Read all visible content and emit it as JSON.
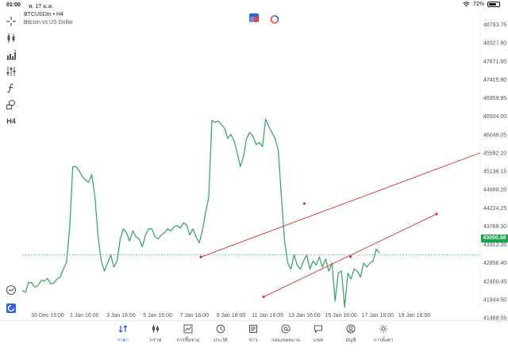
{
  "status_bar": {
    "time": "01:00",
    "date": "พ. 17 ม.ค.",
    "battery": "72%",
    "battery_level": 0.72
  },
  "chart": {
    "symbol": "BTCUSDm",
    "separator": "•",
    "timeframe": "H4",
    "description": "Bitcoin vs US Dollar",
    "last_price": "43050.98",
    "colors": {
      "line": "#3fa66b",
      "trendline": "#e03131",
      "price_tag": "#16a34a"
    }
  },
  "toolbar": {
    "timeframe_button": "H4",
    "icons": [
      "crosshair-icon",
      "candlestick-icon",
      "indicators-icon",
      "settings-sliders-icon",
      "function-icon",
      "objects-icon",
      "timeframe-label"
    ]
  },
  "chart_data": {
    "type": "line",
    "ytick_labels": [
      "48783.75",
      "48327.80",
      "47871.85",
      "47415.90",
      "46959.95",
      "46504.00",
      "46048.05",
      "45592.10",
      "45136.15",
      "44680.20",
      "44224.25",
      "43768.30",
      "43312.35",
      "42856.40",
      "42400.45",
      "41944.50",
      "41488.55"
    ],
    "xtick_labels": [
      "30 Dec 16:00",
      "1 Jan 16:00",
      "3 Jan 16:00",
      "5 Jan 16:00",
      "7 Jan 16:00",
      "9 Jan 16:00",
      "11 Jan 16:00",
      "13 Jan 16:00",
      "15 Jan 16:00",
      "17 Jan 16:00",
      "19 Jan 16:00"
    ],
    "ylim": [
      41488.55,
      48783.75
    ],
    "series": [
      {
        "values": [
          42170,
          42120,
          42370,
          42360,
          42250,
          42290,
          42420,
          42400,
          42470,
          42330,
          42350,
          42450,
          42500,
          42700,
          42870,
          43700,
          45240,
          45250,
          45150,
          45000,
          44920,
          44860,
          45050,
          44500,
          43500,
          42900,
          42650,
          42850,
          43050,
          42750,
          42900,
          43450,
          43700,
          43600,
          43400,
          43650,
          43500,
          43450,
          43250,
          43550,
          43700,
          43700,
          43500,
          43450,
          43550,
          43600,
          43700,
          43650,
          43750,
          43780,
          43720,
          43850,
          43800,
          43550,
          43700,
          43500,
          43350,
          43650,
          44100,
          44500,
          46400,
          46350,
          46380,
          46300,
          46200,
          45950,
          46050,
          45900,
          45600,
          45250,
          45500,
          45950,
          46100,
          46000,
          45800,
          45850,
          45750,
          46430,
          46250,
          46100,
          45950,
          45650,
          44500,
          43400,
          42850,
          42700,
          43050,
          42800,
          42700,
          42900,
          43050,
          42700,
          42900,
          42800,
          43000,
          42750,
          42950,
          42650,
          42850,
          41900,
          42600,
          42650,
          41750,
          42600,
          42450,
          42700,
          42650,
          42500,
          42850,
          42750,
          42850,
          42900,
          43200,
          43100
        ]
      }
    ],
    "current_price": 43050.98,
    "trendlines": [
      {
        "start": [
          "9 Jan 16:00",
          43000
        ],
        "end": [
          "19 Jan 16:00",
          45592.1
        ],
        "control_point": [
          "13 Jan 16:00",
          44330
        ]
      },
      {
        "start": [
          "11 Jan 16:00",
          42010
        ],
        "end": [
          "19 Jan 16:00",
          44070
        ],
        "control_point": [
          "15 Jan 16:00",
          43010
        ]
      }
    ]
  },
  "tabs": [
    {
      "id": "quotes",
      "label": "ราคา",
      "active": true
    },
    {
      "id": "chart",
      "label": "กราฟ",
      "active": false
    },
    {
      "id": "trade",
      "label": "การซื้อขาย",
      "active": false
    },
    {
      "id": "history",
      "label": "ประวัติ",
      "active": false
    },
    {
      "id": "news",
      "label": "ข่าว",
      "active": false
    },
    {
      "id": "mailbox",
      "label": "กล่องจดหมาย",
      "active": false
    },
    {
      "id": "chat",
      "label": "แชท",
      "active": false
    },
    {
      "id": "account",
      "label": "บัญชี",
      "active": false
    },
    {
      "id": "settings",
      "label": "การตั้งค่า",
      "active": false
    }
  ]
}
